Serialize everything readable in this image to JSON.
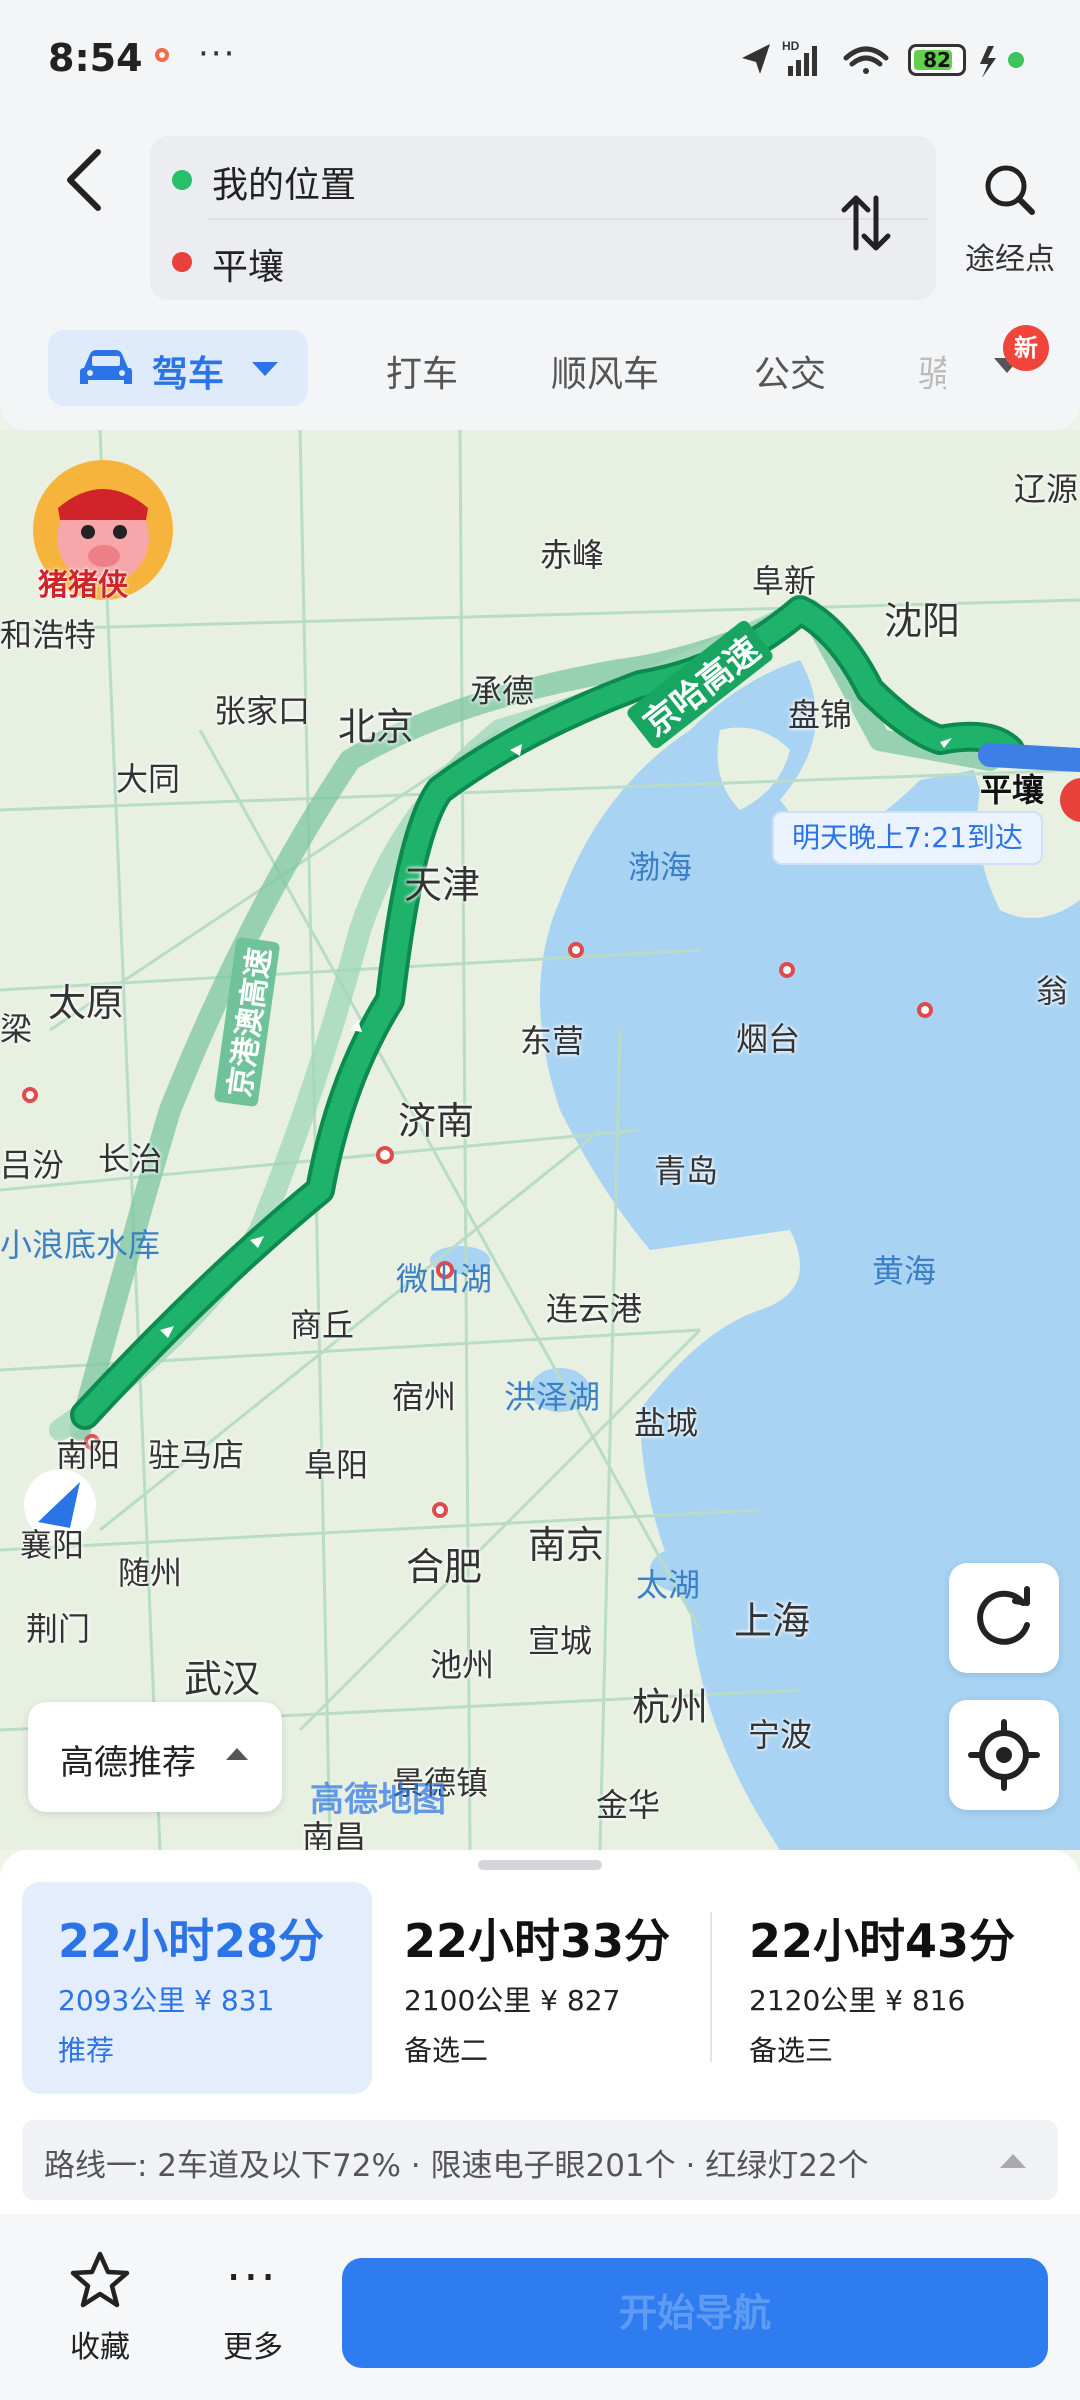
{
  "status_bar": {
    "time": "8:54",
    "more": "···",
    "battery": "82",
    "battery_level_percent": 82
  },
  "header": {
    "origin": "我的位置",
    "destination": "平壤",
    "waypoint_label": "途经点"
  },
  "tabs": {
    "drive": "驾车",
    "taxi": "打车",
    "ride": "顺风车",
    "bus": "公交",
    "cut_tab": "骑",
    "new_badge": "新"
  },
  "map": {
    "cities": {
      "chifeng": "赤峰",
      "fuxin": "阜新",
      "shenyang": "沈阳",
      "liaoyuan": "辽源",
      "hohhot": "和浩特",
      "chengde": "承德",
      "zhangjiakou": "张家口",
      "beijing": "北京",
      "panjin": "盘锦",
      "pyongyang": "平壤",
      "datong": "大同",
      "tianjin": "天津",
      "taiyuan": "太原",
      "dongying": "东营",
      "yantai": "烟台",
      "jinan": "济南",
      "fenyang": "吕汾",
      "changzhi": "长治",
      "qingdao": "青岛",
      "shangqiu": "商丘",
      "lianyungang": "连云港",
      "suzhou_ah": "宿州",
      "yancheng": "盐城",
      "nanyang": "南阳",
      "zhumadian": "驻马店",
      "fuyang": "阜阳",
      "xiangyang": "襄阳",
      "suizhou": "随州",
      "hefei": "合肥",
      "nanjing": "南京",
      "shanghai": "上海",
      "jingmen": "荆门",
      "wuhan": "武汉",
      "xuancheng": "宣城",
      "chizhou": "池州",
      "hangzhou": "杭州",
      "ningbo": "宁波",
      "jinhua": "金华",
      "nanchang": "南昌",
      "jingdezhen": "景德镇",
      "ji_left": "梁",
      "guan_right": "翁"
    },
    "water": {
      "bohai": "渤海",
      "huanghai": "黄海",
      "weishan_lake": "微山湖",
      "hongze_lake": "洪泽湖",
      "tai_lake": "太湖",
      "xiaolangdi": "小浪底水库"
    },
    "roads": {
      "jingha": "京哈高速",
      "jinggang_ao": "京港澳高速"
    },
    "eta": "明天晚上7:21到达",
    "mascot": "猪猪侠",
    "logo": "高德地图",
    "route_pref": "高德推荐"
  },
  "routes": [
    {
      "time": "22小时28分",
      "distance": "2093公里",
      "cost": "¥ 831",
      "tag": "推荐"
    },
    {
      "time": "22小时33分",
      "distance": "2100公里",
      "cost": "¥ 827",
      "tag": "备选二"
    },
    {
      "time": "22小时43分",
      "distance": "2120公里",
      "cost": "¥ 816",
      "tag": "备选三"
    }
  ],
  "route_info": "路线一: 2车道及以下72% · 限速电子眼201个 · 红绿灯22个",
  "bottom": {
    "fav": "收藏",
    "more": "更多",
    "nav": "开始导航"
  },
  "colors": {
    "accent": "#2a74e8",
    "route": "#1aa866",
    "alt_route": "#8fd3b3"
  }
}
